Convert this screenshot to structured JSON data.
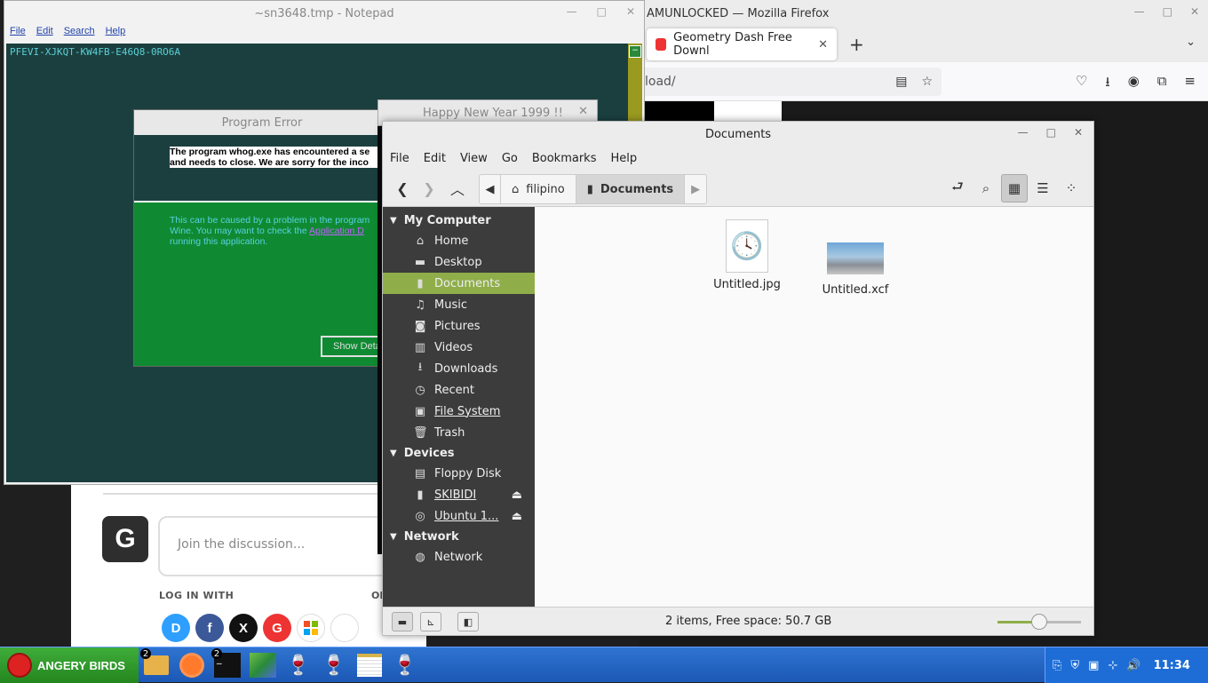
{
  "firefox": {
    "window_title": "AMUNLOCKED — Mozilla Firefox",
    "tab_title": "Geometry Dash Free Downl",
    "url_partial": "load/"
  },
  "disqus": {
    "avatar_letter": "G",
    "join_placeholder": "Join the discussion...",
    "login_with": "LOG IN WITH",
    "or": "OR"
  },
  "notepad": {
    "title": "~sn3648.tmp - Notepad",
    "menu": [
      "File",
      "Edit",
      "Search",
      "Help"
    ],
    "content": "PFEVI-XJKQT-KW4FB-E46Q8-0RO6A"
  },
  "program_error": {
    "title": "Program Error",
    "message_line1": "The program whog.exe has encountered a se",
    "message_line2": "and needs to close. We are sorry for the inco",
    "info_line1": "This can be caused by a problem in the program",
    "info_line2_pre": "Wine. You may want to check the ",
    "info_line2_link": "Application D",
    "info_line3": "running this application.",
    "button": "Show Deta"
  },
  "happy_new_year": {
    "title": "Happy New Year 1999 !!"
  },
  "documents": {
    "title": "Documents",
    "menu": [
      "File",
      "Edit",
      "View",
      "Go",
      "Bookmarks",
      "Help"
    ],
    "breadcrumbs": [
      "filipino",
      "Documents"
    ],
    "sidebar": {
      "sections": [
        {
          "header": "My Computer",
          "items": [
            {
              "label": "Home",
              "icon": "home-icon"
            },
            {
              "label": "Desktop",
              "icon": "desktop-icon"
            },
            {
              "label": "Documents",
              "icon": "document-icon",
              "selected": true
            },
            {
              "label": "Music",
              "icon": "music-icon"
            },
            {
              "label": "Pictures",
              "icon": "camera-icon"
            },
            {
              "label": "Videos",
              "icon": "film-icon"
            },
            {
              "label": "Downloads",
              "icon": "download-icon"
            },
            {
              "label": "Recent",
              "icon": "clock-icon"
            },
            {
              "label": "File System",
              "icon": "drive-icon"
            },
            {
              "label": "Trash",
              "icon": "trash-icon"
            }
          ]
        },
        {
          "header": "Devices",
          "items": [
            {
              "label": "Floppy Disk",
              "icon": "floppy-icon"
            },
            {
              "label": "SKIBIDI",
              "icon": "usb-icon"
            },
            {
              "label": "Ubuntu 1...",
              "icon": "disc-icon"
            }
          ]
        },
        {
          "header": "Network",
          "items": [
            {
              "label": "Network",
              "icon": "network-icon"
            }
          ]
        }
      ]
    },
    "files": [
      {
        "name": "Untitled.jpg"
      },
      {
        "name": "Untitled.xcf"
      }
    ],
    "status": "2 items, Free space: 50.7 GB",
    "zoom_level": 0.5
  },
  "taskbar": {
    "start_label": "ANGERY BIRDS",
    "badges": {
      "files": "2",
      "terminal": "2"
    },
    "clock": "11:34"
  }
}
